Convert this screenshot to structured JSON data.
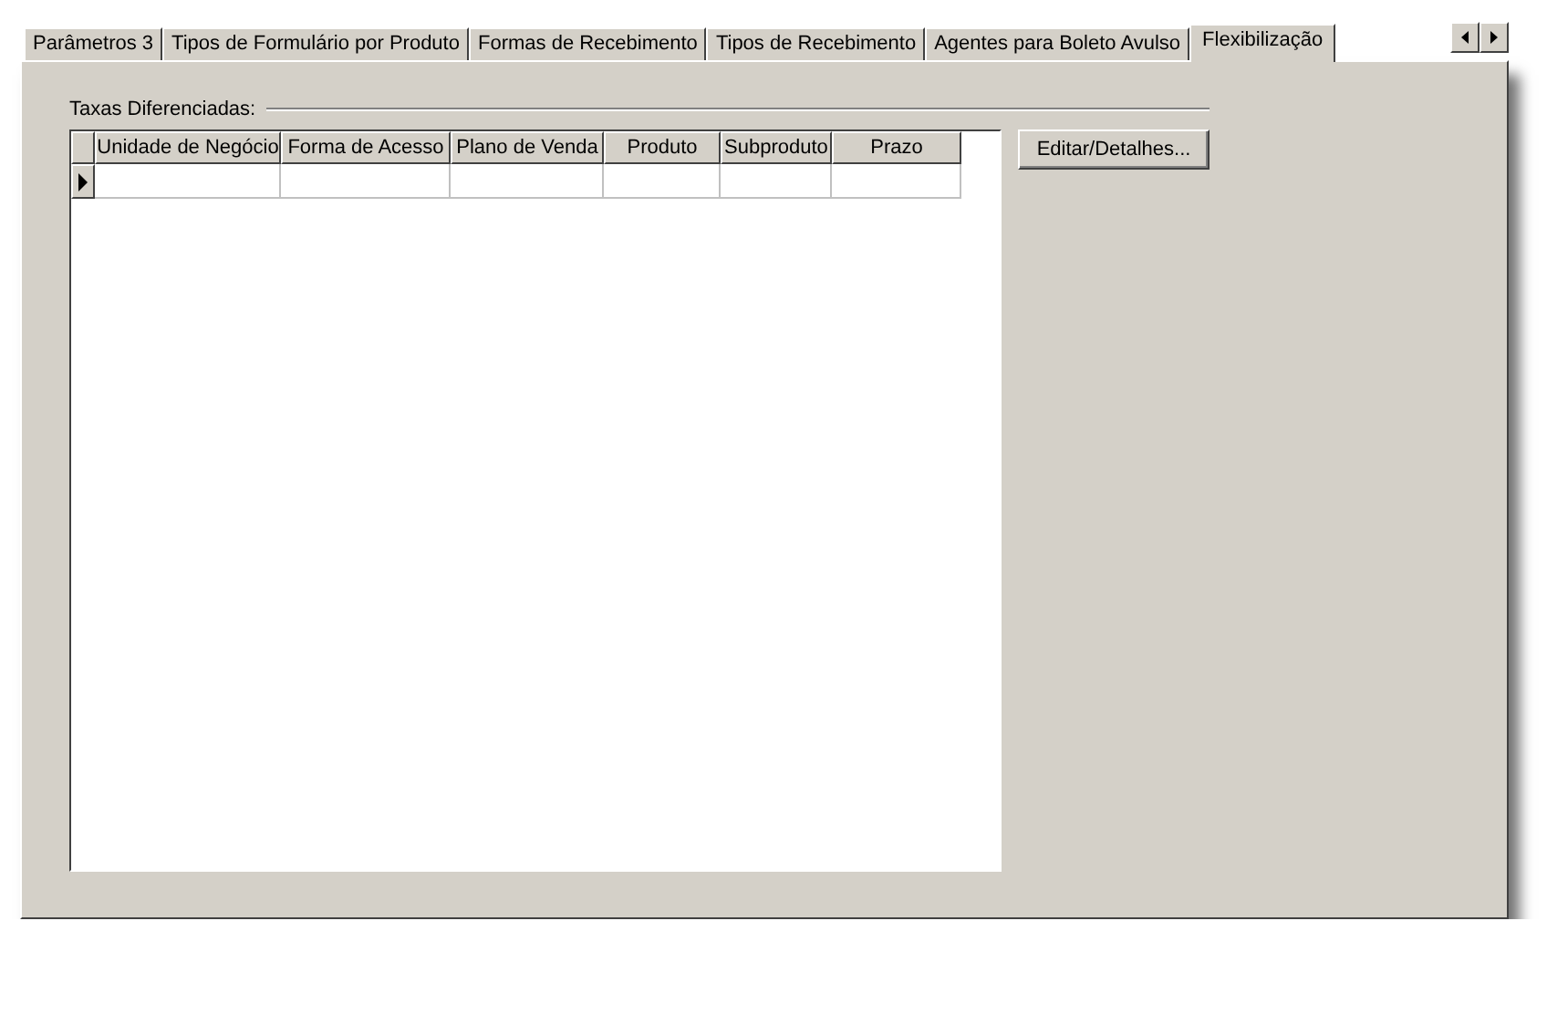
{
  "tabs": [
    {
      "label": "Parâmetros 3",
      "selected": false
    },
    {
      "label": "Tipos de Formulário por Produto",
      "selected": false
    },
    {
      "label": "Formas de Recebimento",
      "selected": false
    },
    {
      "label": "Tipos de Recebimento",
      "selected": false
    },
    {
      "label": "Agentes para Boleto Avulso",
      "selected": false
    },
    {
      "label": "Flexibilização",
      "selected": true
    }
  ],
  "group": {
    "title": "Taxas Diferenciadas:"
  },
  "grid": {
    "columns": [
      "Unidade de Negócio",
      "Forma de Acesso",
      "Plano de Venda",
      "Produto",
      "Subproduto",
      "Prazo"
    ],
    "rows": [
      {
        "selected": true
      }
    ]
  },
  "buttons": [
    "Editar/Detalhes..."
  ]
}
